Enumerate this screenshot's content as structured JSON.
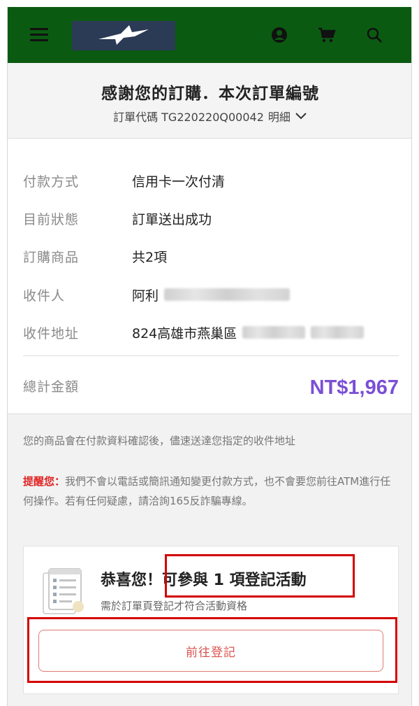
{
  "header": {
    "menu_icon": "hamburger-menu-icon",
    "logo_icon": "bird-logo-icon",
    "user_icon": "user-icon",
    "cart_icon": "shopping-cart-icon",
    "search_icon": "search-icon",
    "colors": {
      "bar": "#0b5a12",
      "logo_bg": "#2b3a55"
    }
  },
  "title": {
    "main": "感謝您的訂購．本次訂單編號",
    "order_code": "訂單代碼 TG220220Q00042",
    "detail_label": "明細",
    "detail_icon": "chevron-down-icon"
  },
  "order_info": {
    "payment_method": {
      "label": "付款方式",
      "value": "信用卡一次付清"
    },
    "status": {
      "label": "目前狀態",
      "value": "訂單送出成功"
    },
    "items": {
      "label": "訂購商品",
      "value": "共2項"
    },
    "recipient": {
      "label": "收件人",
      "value": "阿利"
    },
    "address": {
      "label": "收件地址",
      "value": "824高雄市燕巢區"
    },
    "total": {
      "label": "總計金額",
      "value": "NT$1,967",
      "color": "#7b4fd6"
    }
  },
  "notes": {
    "shipping": "您的商品會在付款資料確認後，儘速送達您指定的收件地址",
    "warning_label": "提醒您：",
    "warning_text": "我們不會以電話或簡訊通知變更付款方式，也不會要您前往ATM進行任何操作。若有任何疑慮，請洽詢165反詐騙專線。"
  },
  "promo": {
    "illustration_icon": "document-checklist-icon",
    "title_prefix": "恭喜您！",
    "title_main": "可參與 1 項登記活動",
    "subtitle": "需於訂單頁登記才符合活動資格",
    "button_label": "前往登記",
    "highlight_color": "#d40000"
  }
}
